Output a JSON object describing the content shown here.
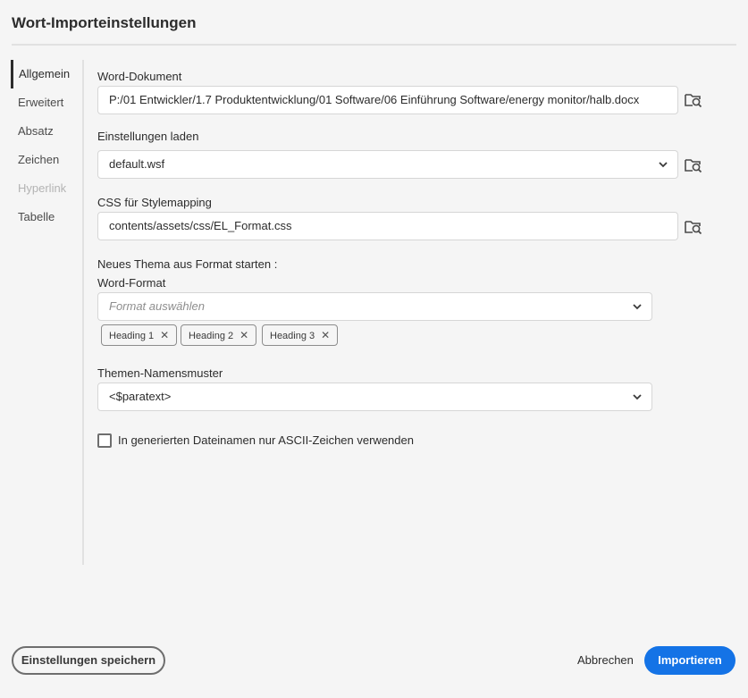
{
  "dialog": {
    "title": "Wort-Importeinstellungen"
  },
  "sidebar": {
    "items": [
      {
        "label": "Allgemein",
        "state": "active"
      },
      {
        "label": "Erweitert",
        "state": "normal"
      },
      {
        "label": "Absatz",
        "state": "normal"
      },
      {
        "label": "Zeichen",
        "state": "normal"
      },
      {
        "label": "Hyperlink",
        "state": "disabled"
      },
      {
        "label": "Tabelle",
        "state": "normal"
      }
    ]
  },
  "form": {
    "word_doc": {
      "label": "Word-Dokument",
      "value": "P:/01 Entwickler/1.7 Produktentwicklung/01 Software/06 Einführung Software/energy monitor/halb.docx",
      "browse_icon": "folder-search-icon"
    },
    "settings": {
      "label": "Einstellungen laden",
      "value": "default.wsf",
      "browse_icon": "folder-search-icon"
    },
    "css": {
      "label": "CSS für Stylemapping",
      "value": "contents/assets/css/EL_Format.css",
      "browse_icon": "folder-search-icon"
    },
    "new_topic": {
      "label": "Neues Thema aus Format starten :"
    },
    "word_format": {
      "label": "Word-Format",
      "placeholder": "Format auswählen",
      "tags": [
        "Heading 1",
        "Heading 2",
        "Heading 3"
      ]
    },
    "naming": {
      "label": "Themen-Namensmuster",
      "value": "<$paratext>"
    },
    "ascii": {
      "label": "In generierten Dateinamen nur ASCII-Zeichen verwenden",
      "checked": false
    }
  },
  "footer": {
    "save_label": "Einstellungen speichern",
    "cancel_label": "Abbrechen",
    "import_label": "Importieren"
  },
  "colors": {
    "accent": "#1473e6",
    "background": "#f5f5f5"
  }
}
